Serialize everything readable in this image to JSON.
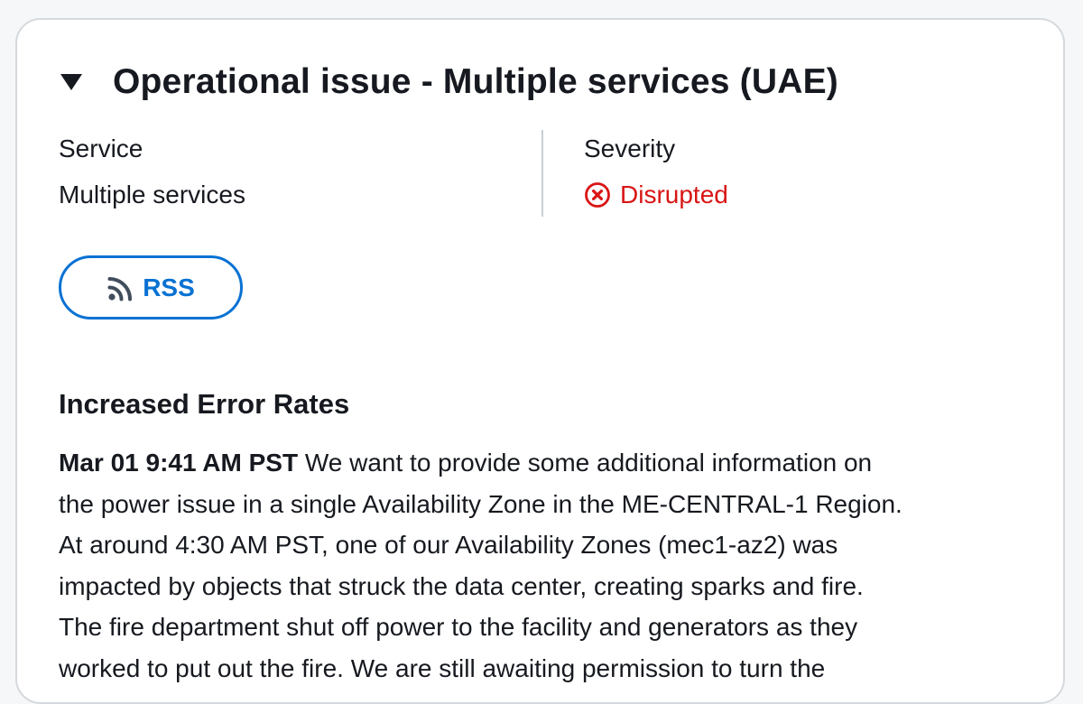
{
  "event": {
    "title": "Operational issue - Multiple services (UAE)",
    "caret_icon": "caret-down-icon"
  },
  "details": {
    "service_label": "Service",
    "service_value": "Multiple services",
    "severity_label": "Severity",
    "severity_value": "Disrupted",
    "severity_icon": "status-negative-icon",
    "severity_color": "#d91515"
  },
  "rss": {
    "label": "RSS",
    "icon": "rss-icon",
    "color": "#0972d3"
  },
  "update": {
    "heading": "Increased Error Rates",
    "timestamp": "Mar 01 9:41 AM PST",
    "lines": [
      " We want to provide some additional information on",
      "the power issue in a single Availability Zone in the ME-CENTRAL-1 Region.",
      "At around 4:30 AM PST, one of our Availability Zones (mec1-az2) was",
      "impacted by objects that struck the data center, creating sparks and fire.",
      "The fire department shut off power to the facility and generators as they",
      "worked to put out the fire. We are still awaiting permission to turn the"
    ]
  }
}
